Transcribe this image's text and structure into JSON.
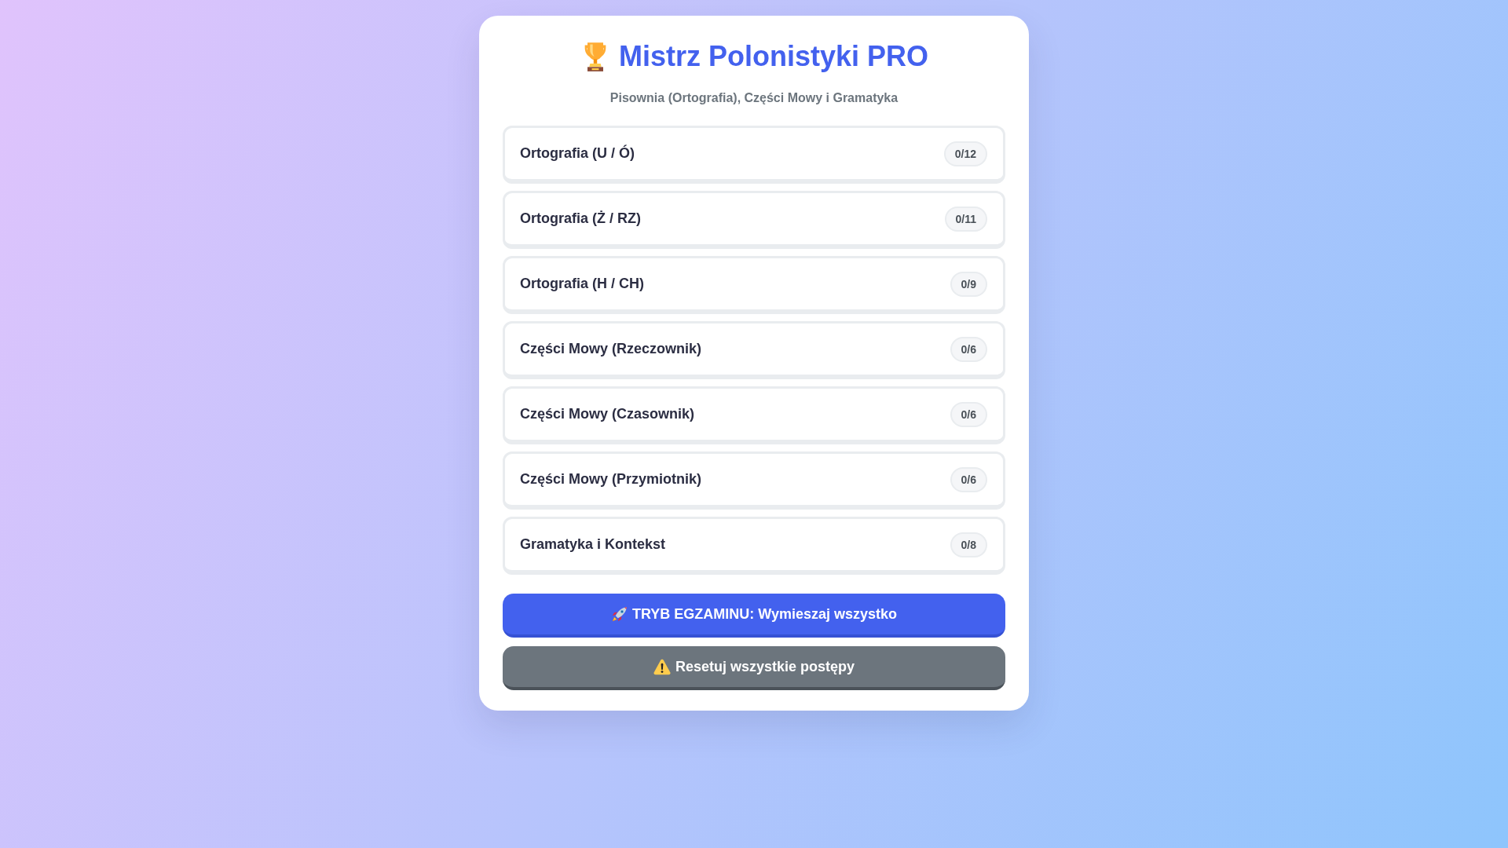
{
  "header": {
    "title": "Mistrz Polonistyki PRO",
    "subtitle": "Pisownia (Ortografia), Części Mowy i Gramatyka"
  },
  "categories": [
    {
      "name": "Ortografia (U / Ó)",
      "score": "0/12"
    },
    {
      "name": "Ortografia (Ż / RZ)",
      "score": "0/11"
    },
    {
      "name": "Ortografia (H / CH)",
      "score": "0/9"
    },
    {
      "name": "Części Mowy (Rzeczownik)",
      "score": "0/6"
    },
    {
      "name": "Części Mowy (Czasownik)",
      "score": "0/6"
    },
    {
      "name": "Części Mowy (Przymiotnik)",
      "score": "0/6"
    },
    {
      "name": "Gramatyka i Kontekst",
      "score": "0/8"
    }
  ],
  "buttons": [
    {
      "label": "TRYB EGZAMINU: Wymieszaj wszystko",
      "kind": "primary"
    },
    {
      "label": "Resetuj wszystkie postępy",
      "kind": "warning"
    }
  ]
}
